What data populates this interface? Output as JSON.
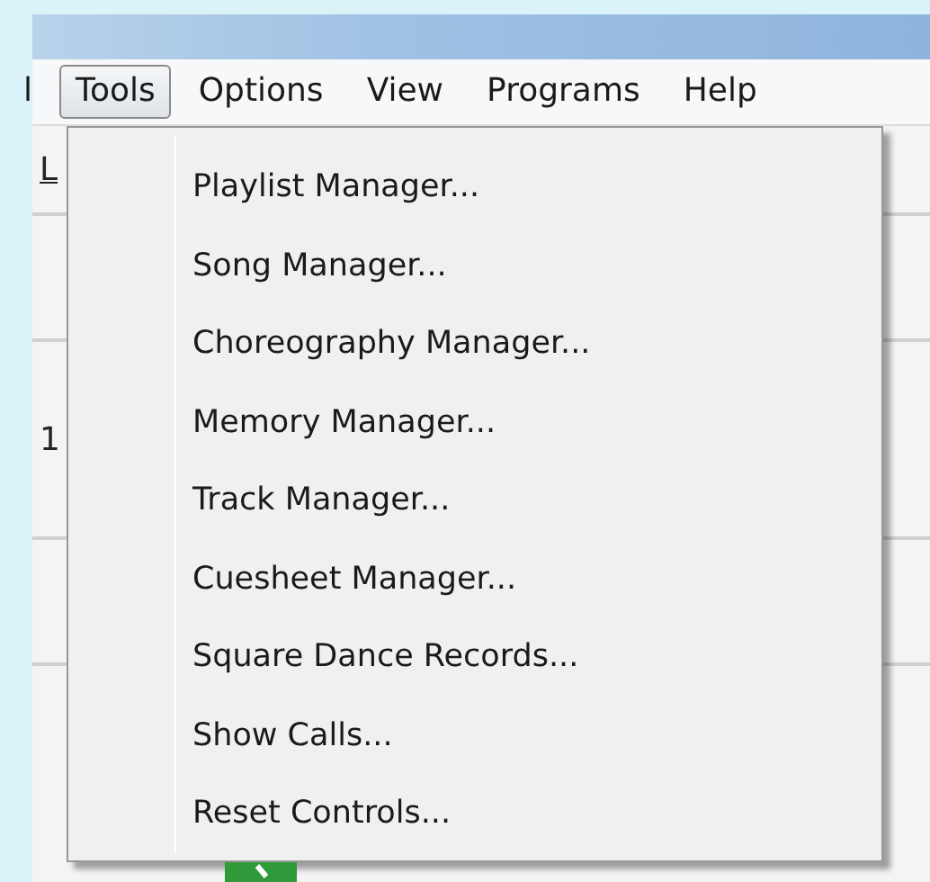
{
  "menu_bar": {
    "items": [
      {
        "label": "l",
        "selected": false
      },
      {
        "label": "Tools",
        "selected": true
      },
      {
        "label": "Options",
        "selected": false
      },
      {
        "label": "View",
        "selected": false
      },
      {
        "label": "Programs",
        "selected": false
      },
      {
        "label": "Help",
        "selected": false
      }
    ]
  },
  "background": {
    "field_text": "L",
    "row_text": "1"
  },
  "dropdown": {
    "items": [
      {
        "label": "Playlist Manager..."
      },
      {
        "label": "Song Manager..."
      },
      {
        "label": "Choreography Manager..."
      },
      {
        "label": "Memory Manager..."
      },
      {
        "label": "Track Manager..."
      },
      {
        "label": "Cuesheet Manager..."
      },
      {
        "label": "Square Dance Records..."
      },
      {
        "label": "Show Calls..."
      },
      {
        "label": "Reset Controls..."
      }
    ]
  }
}
